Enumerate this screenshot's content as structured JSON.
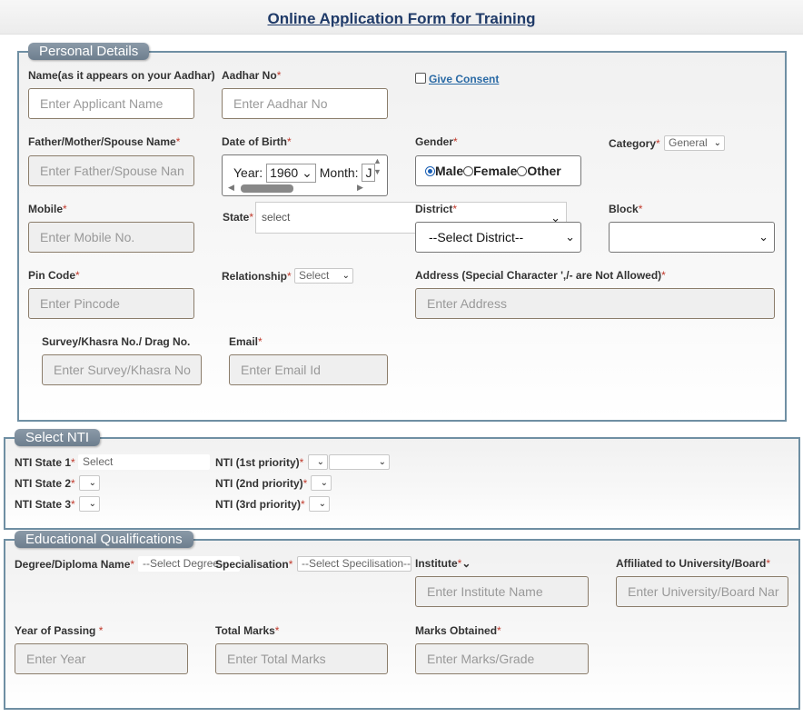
{
  "page": {
    "title": "Online Application Form for Training"
  },
  "personal": {
    "legend": "Personal Details",
    "name_label": "Name(as it appears on your Aadhar)",
    "name_placeholder": "Enter Applicant Name",
    "aadhar_label": "Aadhar No",
    "aadhar_placeholder": "Enter Aadhar No",
    "consent_label": "Give Consent",
    "parent_label": "Father/Mother/Spouse Name",
    "parent_placeholder": "Enter Father/Spouse Nan",
    "dob_label": "Date of Birth",
    "dob_year_label": "Year:",
    "dob_year_value": "1960",
    "dob_month_label": "Month:",
    "dob_month_value": "J",
    "gender_label": "Gender",
    "gender_options": [
      "Male",
      "Female",
      "Other"
    ],
    "gender_selected": "Male",
    "category_label": "Category",
    "category_value": "General",
    "mobile_label": "Mobile",
    "mobile_placeholder": "Enter Mobile No.",
    "state_label": "State",
    "state_value": "select",
    "district_label": "District",
    "district_value": "--Select District--",
    "block_label": "Block",
    "block_value": "",
    "pin_label": "Pin Code",
    "pin_placeholder": "Enter Pincode",
    "relationship_label": "Relationship",
    "relationship_value": "Select",
    "address_label": "Address (Special Character ',/- are Not Allowed)",
    "address_placeholder": "Enter Address",
    "survey_label": "Survey/Khasra No./ Drag No.",
    "survey_placeholder": "Enter Survey/Khasra No",
    "email_label": "Email",
    "email_placeholder": "Enter Email Id",
    "required_mark": "*"
  },
  "nti": {
    "legend": "Select NTI",
    "state1_label": "NTI State 1",
    "state1_value": "Select",
    "state2_label": "NTI State 2",
    "state3_label": "NTI State 3",
    "p1_label": "NTI (1st priority)",
    "p2_label": "NTI (2nd priority)",
    "p3_label": "NTI (3rd priority)"
  },
  "edu": {
    "legend": "Educational Qualifications",
    "degree_label": "Degree/Diploma Name",
    "degree_value": "--Select Degree--",
    "spec_label": "Specialisation",
    "spec_value": "--Select Specilisation--",
    "institute_label": "Institute",
    "institute_placeholder": "Enter Institute Name",
    "univ_label": "Affiliated to University/Board",
    "univ_placeholder": "Enter University/Board Nar",
    "year_label": "Year of Passing ",
    "year_placeholder": "Enter Year",
    "total_label": "Total Marks",
    "total_placeholder": "Enter Total Marks",
    "obtained_label": "Marks Obtained",
    "obtained_placeholder": "Enter Marks/Grade"
  },
  "icons": {
    "dropdown": "chevron-down-icon",
    "scroll_up": "triangle-up-icon",
    "scroll_down": "triangle-down-icon"
  }
}
